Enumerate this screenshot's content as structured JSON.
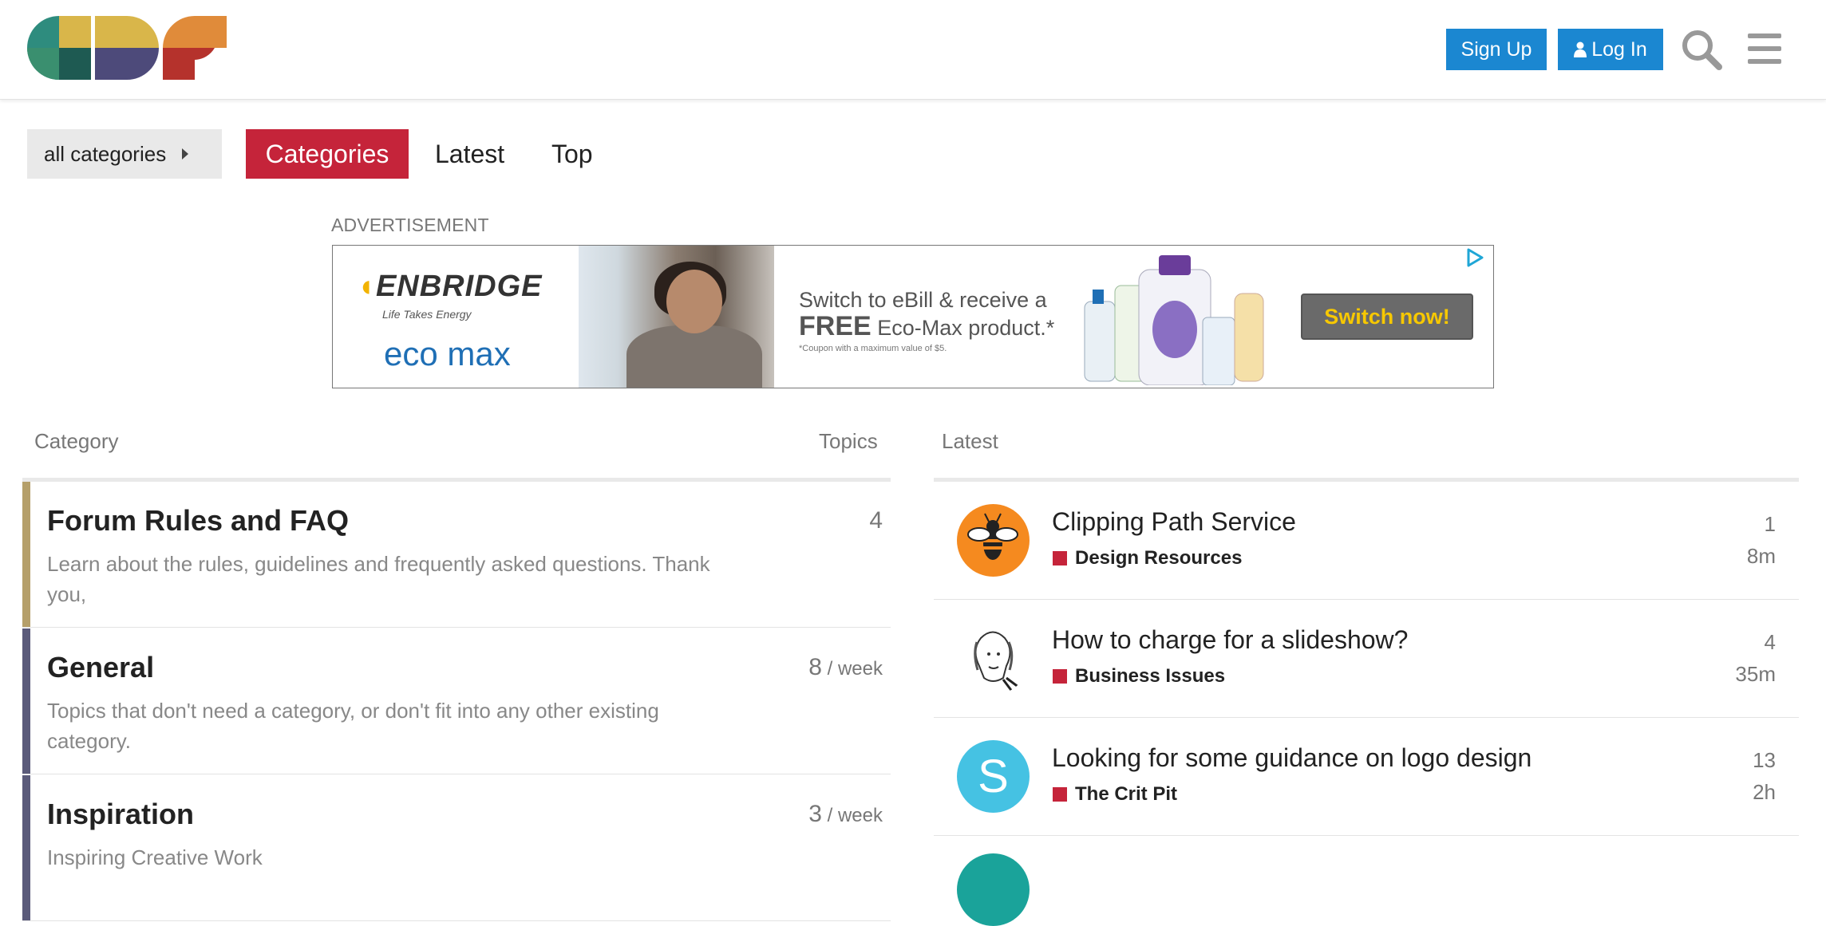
{
  "header": {
    "signup_label": "Sign Up",
    "login_label": "Log In",
    "brand_colors": [
      "#2e8c7e",
      "#d9b64a",
      "#4d4a7a",
      "#e08b3a",
      "#b5322c"
    ]
  },
  "nav": {
    "category_dropdown": "all categories",
    "tabs": [
      {
        "label": "Categories",
        "active": true
      },
      {
        "label": "Latest",
        "active": false
      },
      {
        "label": "Top",
        "active": false
      }
    ],
    "accent_color": "#c5243a"
  },
  "ad": {
    "label": "ADVERTISEMENT",
    "brand": "ENBRIDGE",
    "tagline": "Life Takes Energy",
    "partner": "eco max",
    "headline_line1": "Switch to eBill & receive a",
    "headline_bold": "FREE",
    "headline_line2_rest": " Eco-Max product.*",
    "fine_print": "*Coupon with a maximum value of $5.",
    "cta": "Switch now!"
  },
  "categories": {
    "col_category": "Category",
    "col_topics": "Topics",
    "rows": [
      {
        "name": "Forum Rules and FAQ",
        "description": "Learn about the rules, guidelines and frequently asked questions. Thank you,",
        "count": "4",
        "unit": "",
        "color": "#b59f6a"
      },
      {
        "name": "General",
        "description": "Topics that don't need a category, or don't fit into any other existing category.",
        "count": "8",
        "unit": " / week",
        "color": "#5a5a7a"
      },
      {
        "name": "Inspiration",
        "description": "Inspiring Creative Work",
        "count": "3",
        "unit": " / week",
        "color": "#5a5a7a"
      }
    ]
  },
  "latest": {
    "heading": "Latest",
    "topics": [
      {
        "title": "Clipping Path Service",
        "category": "Design Resources",
        "posts": "1",
        "age": "8m",
        "avatar": "bee-avatar"
      },
      {
        "title": "How to charge for a slideshow?",
        "category": "Business Issues",
        "posts": "4",
        "age": "35m",
        "avatar": "sketch-avatar"
      },
      {
        "title": "Looking for some guidance on logo design",
        "category": "The Crit Pit",
        "posts": "13",
        "age": "2h",
        "avatar": "S"
      }
    ]
  }
}
